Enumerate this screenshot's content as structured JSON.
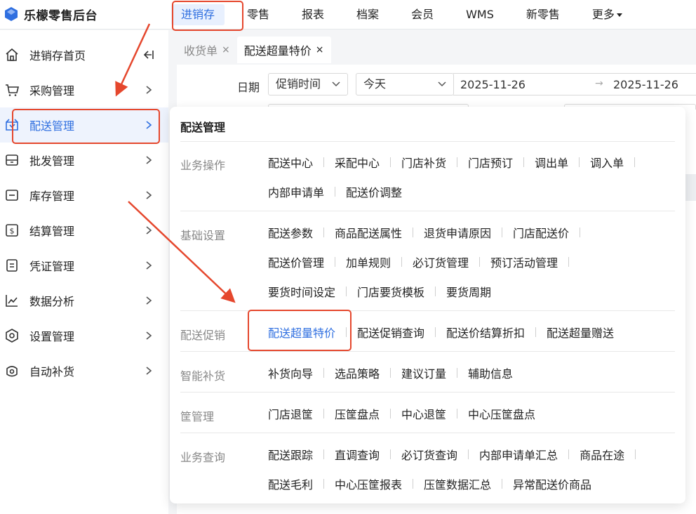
{
  "app": {
    "title": "乐檬零售后台"
  },
  "topnav": {
    "items": [
      {
        "label": "进销存",
        "active": true
      },
      {
        "label": "零售"
      },
      {
        "label": "报表"
      },
      {
        "label": "档案"
      },
      {
        "label": "会员"
      },
      {
        "label": "WMS"
      },
      {
        "label": "新零售"
      },
      {
        "label": "更多"
      }
    ]
  },
  "sidebar": {
    "items": [
      {
        "label": "进销存首页",
        "icon": "home-icon"
      },
      {
        "label": "采购管理",
        "icon": "cart-icon"
      },
      {
        "label": "配送管理",
        "icon": "delivery-icon",
        "active": true
      },
      {
        "label": "批发管理",
        "icon": "wholesale-icon"
      },
      {
        "label": "库存管理",
        "icon": "inventory-icon"
      },
      {
        "label": "结算管理",
        "icon": "settlement-icon"
      },
      {
        "label": "凭证管理",
        "icon": "voucher-icon"
      },
      {
        "label": "数据分析",
        "icon": "chart-icon"
      },
      {
        "label": "设置管理",
        "icon": "settings-icon"
      },
      {
        "label": "自动补货",
        "icon": "auto-replenish-icon"
      }
    ]
  },
  "tabs": [
    {
      "label": "收货单",
      "close": "×"
    },
    {
      "label": "配送超量特价",
      "close": "×",
      "active": true
    }
  ],
  "filter": {
    "date_label": "日期",
    "date_type": "促销时间",
    "date_preset": "今天",
    "date_from": "2025-11-26",
    "date_to": "2025-11-26"
  },
  "panel": {
    "title": "配送管理",
    "groups": [
      {
        "label": "业务操作",
        "rows": [
          [
            "配送中心",
            "采配中心",
            "门店补货",
            "门店预订",
            "调出单",
            "调入单"
          ],
          [
            "内部申请单",
            "配送价调整"
          ]
        ]
      },
      {
        "label": "基础设置",
        "rows": [
          [
            "配送参数",
            "商品配送属性",
            "退货申请原因",
            "门店配送价"
          ],
          [
            "配送价管理",
            "加单规则",
            "必订货管理",
            "预订活动管理"
          ],
          [
            "要货时间设定",
            "门店要货模板",
            "要货周期"
          ]
        ]
      },
      {
        "label": "配送促销",
        "rows": [
          [
            "配送超量特价",
            "配送促销查询",
            "配送价结算折扣",
            "配送超量赠送"
          ]
        ]
      },
      {
        "label": "智能补货",
        "rows": [
          [
            "补货向导",
            "选品策略",
            "建议订量",
            "辅助信息"
          ]
        ]
      },
      {
        "label": "筐管理",
        "rows": [
          [
            "门店退筐",
            "压筐盘点",
            "中心退筐",
            "中心压筐盘点"
          ]
        ]
      },
      {
        "label": "业务查询",
        "rows": [
          [
            "配送跟踪",
            "直调查询",
            "必订货查询",
            "内部申请单汇总",
            "商品在途"
          ],
          [
            "配送毛利",
            "中心压筐报表",
            "压筐数据汇总",
            "异常配送价商品"
          ]
        ]
      }
    ]
  },
  "colors": {
    "accent": "#2f6fe0",
    "annotation": "#e5472d"
  }
}
